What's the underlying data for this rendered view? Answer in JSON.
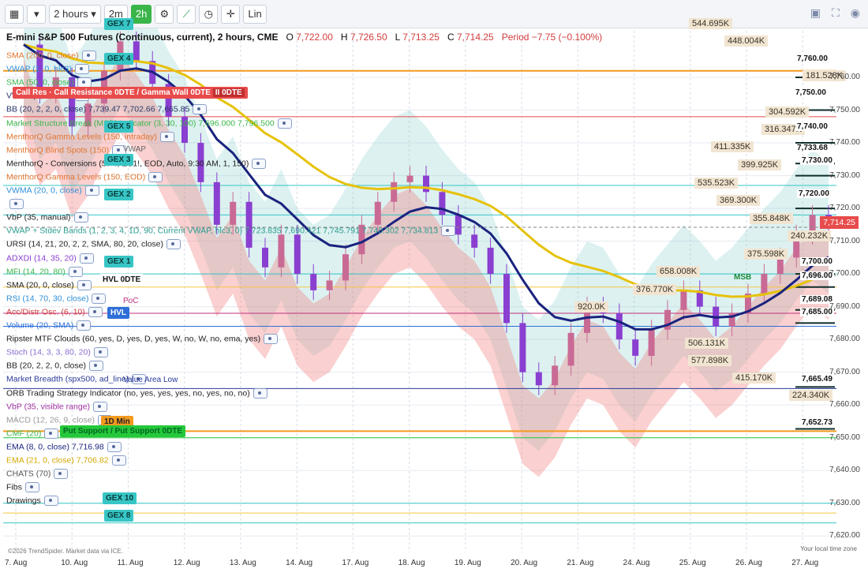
{
  "toolbar": {
    "interval": "2 hours",
    "btn_2m": "2m",
    "btn_2h": "2h",
    "btn_lin": "Lin"
  },
  "header": {
    "title": "E-mini S&P 500 Futures (Continuous, current), 2 hours, CME",
    "o_label": "O",
    "o": "7,722.00",
    "h_label": "H",
    "h": "7,726.50",
    "l_label": "L",
    "l": "7,713.25",
    "c_label": "C",
    "c": "7,714.25",
    "period": "Period −7.75 (−0.100%)"
  },
  "indicators": [
    {
      "text": "SMA (200, 0, close)",
      "color": "#e0762f"
    },
    {
      "text": "VWAP (1, 0, hlc3)",
      "color": "#2e8fd8"
    },
    {
      "text": "SMA (50, 0, close)",
      "color": "#3bb54a"
    },
    {
      "text": "VWAP (2, 0, hlc3)",
      "color": "#2a3a6a"
    },
    {
      "text": "BB (20, 2, 2, 0, close)  7,739.47  7,702.66  7,665.85",
      "color": "#2a3a6a"
    },
    {
      "text": "Market Structure Break (MSB) Indicator (3, 30, 100)  7,696.000  7,796.500",
      "color": "#3bb54a"
    },
    {
      "text": "MenthorQ Gamma Levels (150, intraday)",
      "color": "#e0762f"
    },
    {
      "text": "MenthorQ Blind Spots (150)",
      "color": "#e0762f"
    },
    {
      "text": "MenthorQ - Conversions (SPY, ES1!, EOD, Auto, 9:30 AM, 1, 150)",
      "color": "#222"
    },
    {
      "text": "MenthorQ Gamma Levels (150, EOD)",
      "color": "#e0762f"
    },
    {
      "text": "VWMA (20, 0, close)",
      "color": "#2e8fd8"
    },
    {
      "text": "",
      "color": "#c33"
    },
    {
      "text": "VbP (35, manual)",
      "color": "#222"
    },
    {
      "text": "VWAP + Stdev Bands (1, 2, 3, 4, 1D, 90, Current VWAP, hlc3, 0)  7,723.835  7,690.421  7,745.791  7,740.302  7,734.813",
      "color": "#2a9d8f"
    },
    {
      "text": "URSI (14, 21, 20, 2, 2, SMA, 80, 20, close)",
      "color": "#222"
    },
    {
      "text": "ADXDI (14, 35, 20)",
      "color": "#8a3fd0"
    },
    {
      "text": "MFI (14, 20, 80)",
      "color": "#3bb54a"
    },
    {
      "text": "SMA (20, 0, close)",
      "color": "#222"
    },
    {
      "text": "RSI (14, 70, 30, close)",
      "color": "#2e8fd8"
    },
    {
      "text": "Acc/Distr Osc. (6, 10)",
      "color": "#d23c3c"
    },
    {
      "text": "Volume (20, SMA)",
      "color": "#2e6fd8"
    },
    {
      "text": "Ripster MTF Clouds (60, yes, D, yes, D, yes, W, no, W, no, ema, yes)",
      "color": "#222"
    },
    {
      "text": "Stoch (14, 3, 3, 80, 20)",
      "color": "#8a6fd0"
    },
    {
      "text": "BB (20, 2, 2, 0, close)",
      "color": "#222"
    },
    {
      "text": "Market Breadth (spx500, ad_line)",
      "color": "#2a3a9a"
    },
    {
      "text": "ORB Trading Strategy Indicator (no, yes, yes, yes, no, yes, no, no)",
      "color": "#222"
    },
    {
      "text": "VbP (35, visible range)",
      "color": "#a033a0"
    },
    {
      "text": "MACD (12, 26, 9, close)",
      "color": "#999"
    },
    {
      "text": "CMF (20)",
      "color": "#3bb54a"
    },
    {
      "text": "EMA (8, 0, close)  7,716.98",
      "color": "#1a237e"
    },
    {
      "text": "EMA (21, 0, close)  7,706.82",
      "color": "#d4a800"
    },
    {
      "text": "CHATS (70)",
      "color": "#555"
    },
    {
      "text": "Fibs",
      "color": "#222"
    },
    {
      "text": "Drawings",
      "color": "#222"
    }
  ],
  "gex_tags": [
    "GEX 7",
    "GEX 4",
    "GEX 5",
    "GEX 3",
    "GEX 2",
    "GEX 1",
    "GEX 10",
    "GEX 8"
  ],
  "tags": {
    "call_resistance": "Call Resistance 0DTE / Gamma Wall 0DTE",
    "call_res_short": "Call Res",
    "hvl_0dte": "HVL 0DTE",
    "hvl": "HVL",
    "poc": "PoC",
    "vwap": "VWAP",
    "value_area_low": "Value Area Low",
    "one_d_min": "1D Min",
    "put_support": "Put Support / Put Support 0DTE",
    "msb": "MSB"
  },
  "volume_levels": [
    "544.695K",
    "448.004K",
    "181.528K",
    "304.592K",
    "316.347K",
    "411.335K",
    "399.925K",
    "535.523K",
    "369.300K",
    "355.848K",
    "240.232K",
    "375.598K",
    "658.008K",
    "415.170K",
    "224.340K",
    "506.131K",
    "577.898K",
    "376.770K",
    "920.0K"
  ],
  "right_levels": [
    "7,760.00",
    "7,750.00",
    "7,740.00",
    "7,733.68",
    "7,730.00",
    "7,720.00",
    "7,700.00",
    "7,696.00",
    "7,689.08",
    "7,685.00",
    "7,665.49",
    "7,652.73"
  ],
  "price_tag": "7,714.25",
  "footer_left": "©2026 TrendSpider. Market data via ICE.",
  "footer_right": "Your local time zone",
  "watermark": "E-mini S&P 500 Futures (Continuous, current)",
  "chart_data": {
    "type": "candlestick",
    "title": "E-mini S&P 500 Futures (Continuous, current), 2 hours, CME",
    "x_labels": [
      "7. Aug",
      "10. Aug",
      "11. Aug",
      "12. Aug",
      "13. Aug",
      "14. Aug",
      "17. Aug",
      "18. Aug",
      "19. Aug",
      "20. Aug",
      "21. Aug",
      "24. Aug",
      "25. Aug",
      "26. Aug",
      "27. Aug"
    ],
    "y_ticks": [
      7620,
      7630,
      7640,
      7650,
      7660,
      7670,
      7680,
      7690,
      7700,
      7710,
      7720,
      7730,
      7740,
      7750,
      7760
    ],
    "ylim": [
      7615,
      7780
    ],
    "last_price": 7714.25,
    "series_close": [
      7770,
      7755,
      7760,
      7745,
      7752,
      7762,
      7771,
      7765,
      7758,
      7748,
      7740,
      7728,
      7715,
      7722,
      7708,
      7702,
      7712,
      7700,
      7695,
      7698,
      7706,
      7715,
      7722,
      7728,
      7730,
      7725,
      7718,
      7712,
      7708,
      7700,
      7685,
      7670,
      7666,
      7672,
      7682,
      7690,
      7688,
      7680,
      7675,
      7683,
      7689,
      7695,
      7690,
      7684,
      7688,
      7694,
      7700,
      7705,
      7712,
      7718,
      7714
    ]
  }
}
